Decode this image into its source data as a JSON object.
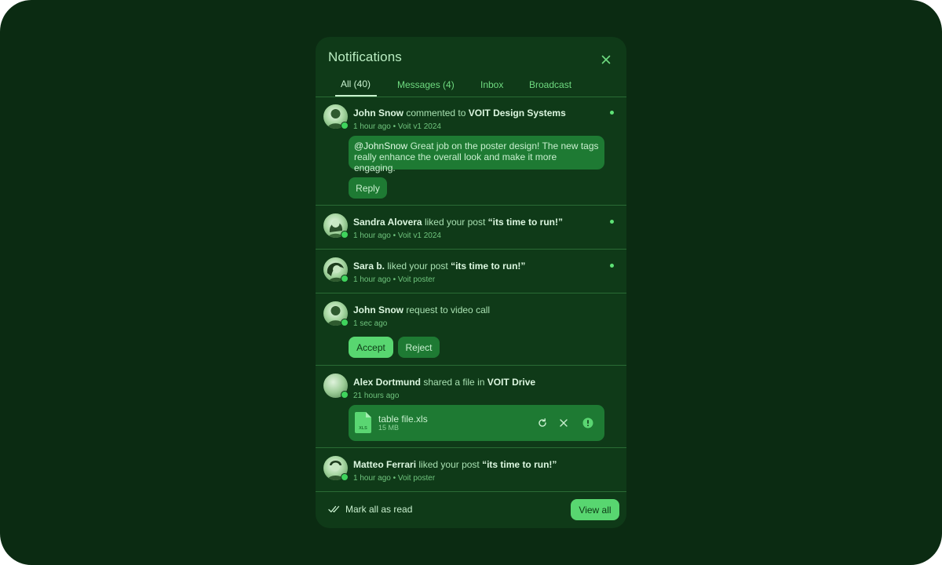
{
  "panel": {
    "title": "Notifications",
    "tabs": [
      "All (40)",
      "Messages (4)",
      "Inbox",
      "Broadcast"
    ]
  },
  "notifications": [
    {
      "user": "John Snow",
      "action": "commented to",
      "target": "VOIT Design Systems",
      "time": "1 hour ago",
      "source": "Voit v1 2024",
      "mention": "@JohnSnow",
      "message_rest": " Great job on the poster design! The new tags really enhance the overall look and make it more engaging.",
      "reply_label": "Reply"
    },
    {
      "user": "Sandra Alovera",
      "action": "liked your post",
      "target": "“its time to run!”",
      "time": "1 hour ago",
      "source": "Voit v1 2024"
    },
    {
      "user": "Sara b.",
      "action": "liked your post",
      "target": "“its time to run!”",
      "time": "1 hour ago",
      "source": "Voit poster"
    },
    {
      "user": "John Snow",
      "action": "request to video call",
      "time": "1 sec ago",
      "accept_label": "Accept",
      "reject_label": "Reject"
    },
    {
      "user": "Alex Dortmund",
      "action": "shared a file in",
      "target": "VOIT Drive",
      "time": "21 hours ago",
      "file_name": "table file.xls",
      "file_size": "15 MB",
      "file_type": "XLS"
    },
    {
      "user": "Matteo Ferrari",
      "action": "liked your post",
      "target": "“its time to run!”",
      "time": "1 hour ago",
      "source": "Voit poster"
    }
  ],
  "separator": "•",
  "footer": {
    "mark_all_label": "Mark all as read",
    "view_all_label": "View all"
  },
  "icons": {
    "close": "close-icon",
    "mark_read": "double-check-icon",
    "retry": "refresh-icon",
    "cancel": "close-icon",
    "warning": "alert-circle-icon",
    "file": "file-xls-icon"
  },
  "colors": {
    "background": "#0b2b12",
    "panel": "#0f3a18",
    "accent": "#58d670",
    "bubble": "#1e7a33",
    "online": "#3fd35c"
  }
}
